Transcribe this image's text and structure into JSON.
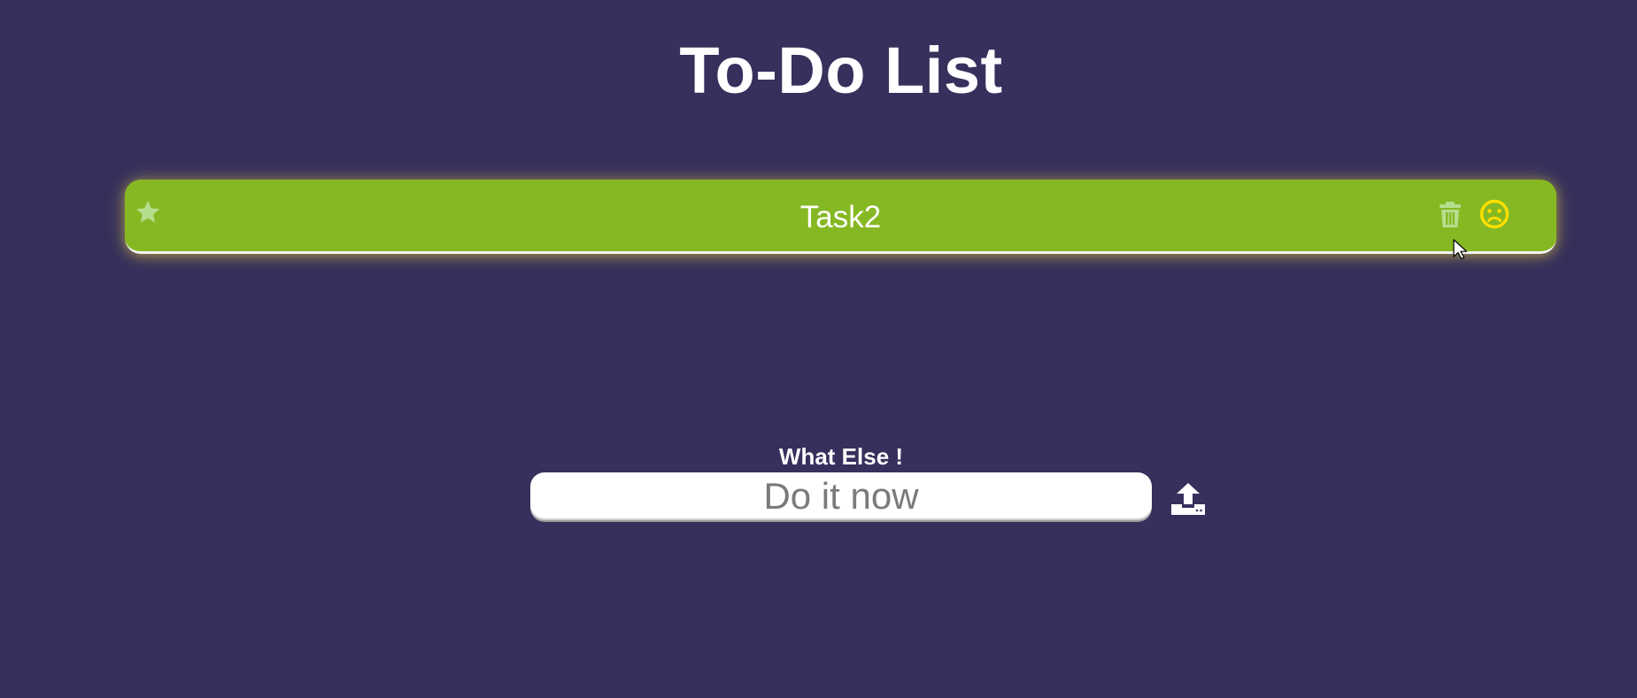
{
  "header": {
    "title": "To-Do List"
  },
  "tasks": [
    {
      "label": "Task2",
      "star_icon": "star-icon",
      "delete_icon": "trash-icon",
      "mood_icon": "sad-face-icon"
    }
  ],
  "input": {
    "label": "What Else !",
    "placeholder": "Do it now",
    "value": "",
    "submit_icon": "upload-icon"
  },
  "colors": {
    "background": "#35305c",
    "task_background": "#86b823",
    "task_glow": "#ffe23c",
    "mood_icon": "#ffe000",
    "muted_icon": "#b4de8e",
    "text": "#ffffff"
  }
}
